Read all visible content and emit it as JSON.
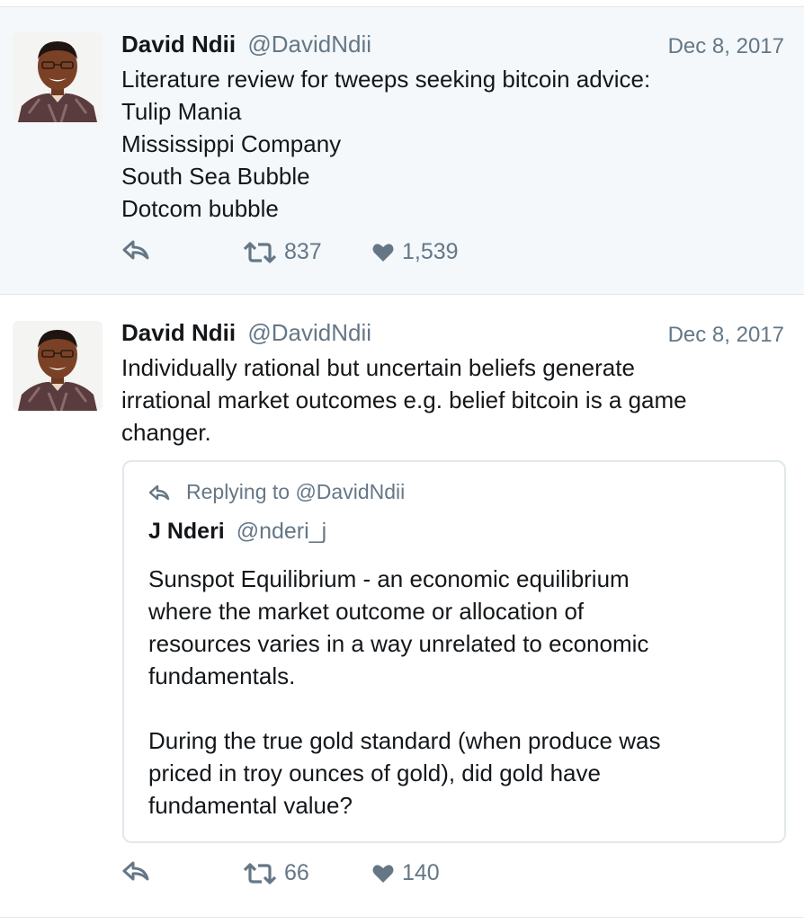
{
  "tweets": [
    {
      "author_name": "David Ndii",
      "author_handle": "@DavidNdii",
      "date": "Dec 8, 2017",
      "text_lines": [
        "Literature review for tweeps seeking bitcoin advice:",
        "Tulip Mania",
        "Mississippi Company",
        "South Sea Bubble",
        "Dotcom bubble"
      ],
      "retweets": "837",
      "likes": "1,539"
    },
    {
      "author_name": "David Ndii",
      "author_handle": "@DavidNdii",
      "date": "Dec 8, 2017",
      "text_lines": [
        "Individually rational but uncertain beliefs generate",
        "irrational market outcomes e.g. belief bitcoin is a game",
        "changer."
      ],
      "retweets": "66",
      "likes": "140",
      "quoted": {
        "replying_to": "Replying to @DavidNdii",
        "author_name": "J Nderi",
        "author_handle": "@nderi_j",
        "paragraph1_lines": [
          "Sunspot Equilibrium - an economic equilibrium",
          "where the market outcome or allocation of",
          "resources varies in a way unrelated to economic",
          "fundamentals."
        ],
        "paragraph2_lines": [
          "During the true gold standard (when produce was",
          "priced in troy ounces of gold), did gold have",
          "fundamental value?"
        ]
      }
    }
  ],
  "icons": {
    "reply": "reply-icon",
    "retweet": "retweet-icon",
    "like": "heart-icon"
  },
  "colors": {
    "secondary_text": "#657786",
    "highlight_background": "#f5f8fa",
    "border": "#e1e8ed"
  }
}
